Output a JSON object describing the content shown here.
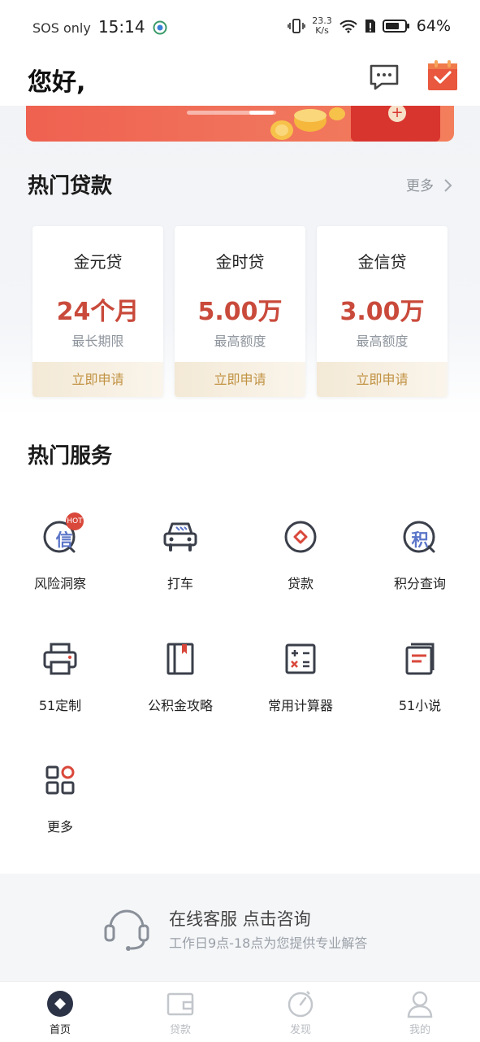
{
  "status_bar": {
    "carrier": "SOS only",
    "time": "15:14",
    "speed_value": "23.3",
    "speed_unit": "K/s",
    "battery": "64%"
  },
  "header": {
    "greeting": "您好,"
  },
  "hot_loans": {
    "title": "热门贷款",
    "more": "更多",
    "cards": [
      {
        "name": "金元贷",
        "amount": "24个月",
        "subtitle": "最长期限",
        "apply": "立即申请"
      },
      {
        "name": "金时贷",
        "amount": "5.00万",
        "subtitle": "最高额度",
        "apply": "立即申请"
      },
      {
        "name": "金信贷",
        "amount": "3.00万",
        "subtitle": "最高额度",
        "apply": "立即申请"
      }
    ]
  },
  "hot_services": {
    "title": "热门服务",
    "hot_badge": "HOT",
    "items": [
      {
        "label": "风险洞察",
        "icon": "risk-insight-icon",
        "glyph": "信"
      },
      {
        "label": "打车",
        "icon": "car-icon"
      },
      {
        "label": "贷款",
        "icon": "loan-icon"
      },
      {
        "label": "积分查询",
        "icon": "points-query-icon",
        "glyph": "积"
      },
      {
        "label": "51定制",
        "icon": "printer-icon"
      },
      {
        "label": "公积金攻略",
        "icon": "book-icon"
      },
      {
        "label": "常用计算器",
        "icon": "calculator-icon"
      },
      {
        "label": "51小说",
        "icon": "novel-icon"
      },
      {
        "label": "更多",
        "icon": "more-grid-icon"
      }
    ]
  },
  "customer_service": {
    "title": "在线客服 点击咨询",
    "subtitle": "工作日9点-18点为您提供专业解答"
  },
  "tabbar": [
    {
      "label": "首页",
      "icon": "home-icon",
      "active": true
    },
    {
      "label": "贷款",
      "icon": "wallet-icon",
      "active": false
    },
    {
      "label": "发现",
      "icon": "discover-icon",
      "active": false
    },
    {
      "label": "我的",
      "icon": "profile-icon",
      "active": false
    }
  ],
  "colors": {
    "accent_red": "#c94a3b",
    "gold": "#c19243",
    "banner_red": "#ef6150"
  }
}
